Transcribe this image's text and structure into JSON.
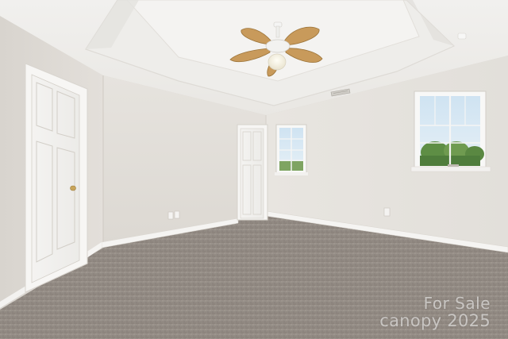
{
  "watermark": {
    "line1": "For Sale",
    "line2": "canopy 2025"
  }
}
